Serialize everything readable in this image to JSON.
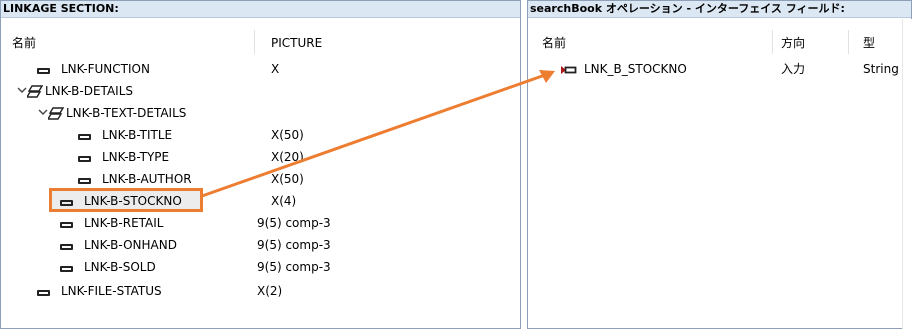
{
  "left": {
    "header": "LINKAGE SECTION:",
    "col_name": "名前",
    "col_picture": "PICTURE",
    "rows": [
      {
        "label": "LNK-FUNCTION",
        "pic": "X",
        "type": "field"
      },
      {
        "label": "LNK-B-DETAILS",
        "pic": "",
        "type": "group"
      },
      {
        "label": "LNK-B-TEXT-DETAILS",
        "pic": "",
        "type": "group"
      },
      {
        "label": "LNK-B-TITLE",
        "pic": "X(50)",
        "type": "field"
      },
      {
        "label": "LNK-B-TYPE",
        "pic": "X(20)",
        "type": "field"
      },
      {
        "label": "LNK-B-AUTHOR",
        "pic": "X(50)",
        "type": "field"
      },
      {
        "label": "LNK-B-STOCKNO",
        "pic": "X(4)",
        "type": "field"
      },
      {
        "label": "LNK-B-RETAIL",
        "pic": "9(5) comp-3",
        "type": "field"
      },
      {
        "label": "LNK-B-ONHAND",
        "pic": "9(5) comp-3",
        "type": "field"
      },
      {
        "label": "LNK-B-SOLD",
        "pic": "9(5) comp-3",
        "type": "field"
      },
      {
        "label": "LNK-FILE-STATUS",
        "pic": "X(2)",
        "type": "field"
      }
    ]
  },
  "right": {
    "header": "searchBook オペレーション - インターフェイス フィールド:",
    "col_name": "名前",
    "col_direction": "方向",
    "col_type": "型",
    "rows": [
      {
        "label": "LNK_B_STOCKNO",
        "direction": "入力",
        "type": "String"
      }
    ]
  },
  "colors": {
    "highlight": "#ed7d31",
    "header_bg": "#dce7f4",
    "input_icon": "#b01818"
  }
}
